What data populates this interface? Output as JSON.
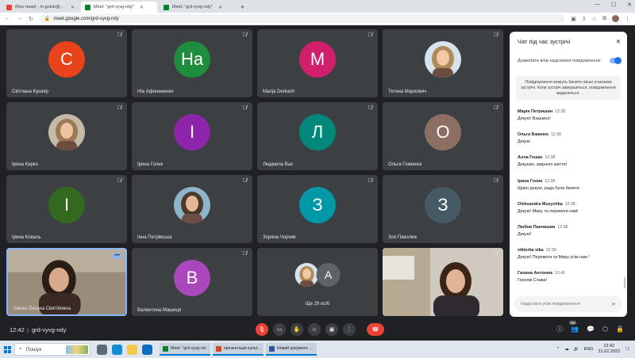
{
  "browser": {
    "tabs": [
      {
        "title": "(Без теми) - m.golub@ippo.edu.ua",
        "favicon_color": "#ea4335",
        "active": false
      },
      {
        "title": "Meet: \"grd-vyvg-ndy\"",
        "favicon_color": "#00832d",
        "active": true
      },
      {
        "title": "Meet: \"grd-vyvg-ndy\"",
        "favicon_color": "#00832d",
        "active": false
      }
    ],
    "new_tab_label": "+",
    "url": "meet.google.com/grd-vyvg-ndy"
  },
  "tiles": [
    {
      "name": "Світлана Кушнір",
      "type": "initial",
      "initial": "С",
      "color": "#e8431a"
    },
    {
      "name": "Ніа Афонаненко",
      "type": "initial",
      "initial": "На",
      "color": "#1e8e3e"
    },
    {
      "name": "Marija Derkach",
      "type": "initial",
      "initial": "M",
      "color": "#d0206b"
    },
    {
      "name": "Тетяна Маркович",
      "type": "photo"
    },
    {
      "name": "Ірина Карко",
      "type": "photo"
    },
    {
      "name": "Ірина Голик",
      "type": "initial",
      "initial": "І",
      "color": "#8e24aa"
    },
    {
      "name": "Людмила Вах",
      "type": "initial",
      "initial": "Л",
      "color": "#00897b"
    },
    {
      "name": "Ольга Гоменюк",
      "type": "initial",
      "initial": "О",
      "color": "#8d6e63"
    },
    {
      "name": "Ірина Коваль",
      "type": "initial",
      "initial": "І",
      "color": "#33691e"
    },
    {
      "name": "Інна Петрівська",
      "type": "photo"
    },
    {
      "name": "Зоряна Чорняк",
      "type": "initial",
      "initial": "З",
      "color": "#0097a7"
    },
    {
      "name": "Зоя Паколюк",
      "type": "initial",
      "initial": "З",
      "color": "#455a64"
    },
    {
      "name": "Свєва Оксана Святійовна",
      "type": "video-self"
    },
    {
      "name": "Валентина Машиця",
      "type": "initial",
      "initial": "В",
      "color": "#ab47bc"
    },
    {
      "name": "Ще 29 осіб",
      "type": "others",
      "initial": "A"
    },
    {
      "name": "",
      "type": "video"
    }
  ],
  "chat": {
    "title": "Чат під час зустрічі",
    "allow_label": "Дозволити всім надсилати повідомлення",
    "info": "Повідомлення можуть бачити лише учасники зустрічі. Коли зустріч завершиться, повідомлення видаляться.",
    "messages": [
      {
        "author": "Марія Петришин",
        "time": "12:38",
        "text": "Дякую! Взаємно!"
      },
      {
        "author": "Ольга Бжанюк",
        "time": "12:38",
        "text": "Дякую"
      },
      {
        "author": "Алла Гешко",
        "time": "12:38",
        "text": "Дякуємо, мирного життя!"
      },
      {
        "author": "Ірина Голик",
        "time": "12:38",
        "text": "Щиро дякую, рада була бачити"
      },
      {
        "author": "Oleksandra Muzychka",
        "time": "12:38",
        "text": "Дякую! Миру та перемоги нам!"
      },
      {
        "author": "Любов Панчишин",
        "time": "12:38",
        "text": "Дякую!"
      },
      {
        "author": "viktoriia vika",
        "time": "12:39",
        "text": "Дякую! Перемоги та Миру усім нам !"
      },
      {
        "author": "Галина Антонюк",
        "time": "12:41",
        "text": "Героям Слава!"
      }
    ],
    "input_placeholder": "Надіслати усім повідомлення"
  },
  "meeting": {
    "time": "12:42",
    "separator": "|",
    "code": "grd-vyvg-ndy",
    "participant_count": "44"
  },
  "taskbar": {
    "search_label": "Пошук",
    "apps": [
      {
        "title": "Meet: \"grd-vyvg-nd...",
        "color": "#00832d"
      },
      {
        "title": "презентація культ...",
        "color": "#d24726"
      },
      {
        "title": "Новий документ ...",
        "color": "#2b579a"
      }
    ],
    "lang": "ENG",
    "time": "12:42",
    "date": "21.02.2023"
  }
}
